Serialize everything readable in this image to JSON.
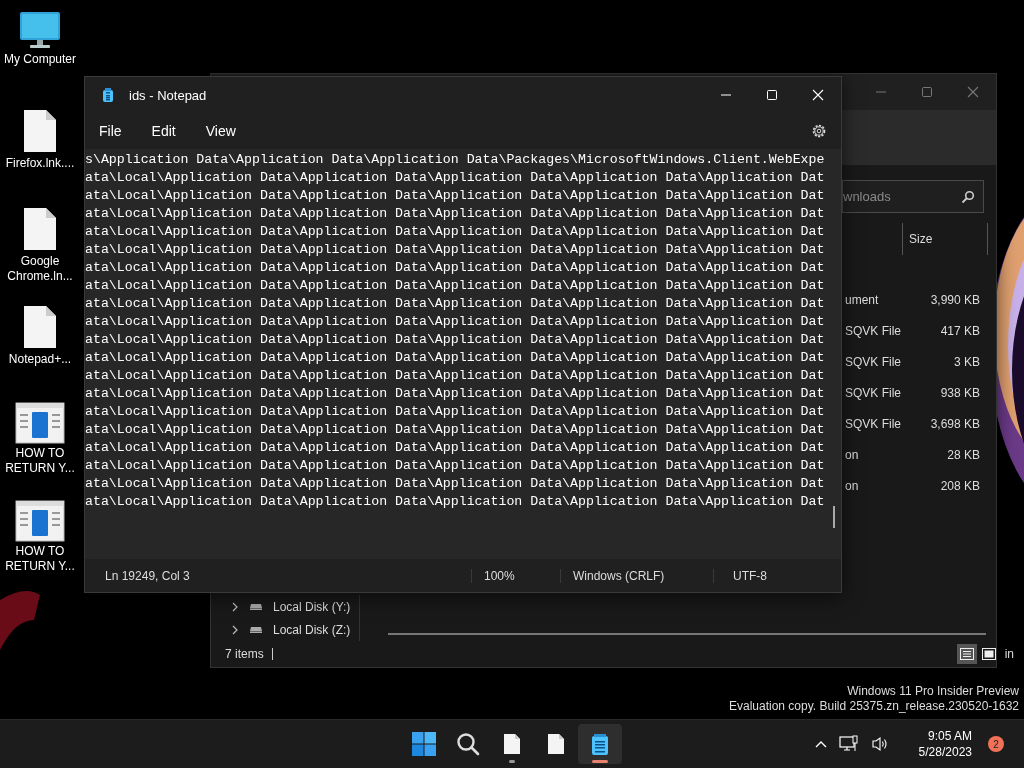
{
  "desktop_icons": [
    {
      "label": "My Computer",
      "kind": "computer"
    },
    {
      "label": "Firefox.lnk....",
      "kind": "file"
    },
    {
      "label": "Google Chrome.ln...",
      "kind": "file"
    },
    {
      "label": "Notepad+...",
      "kind": "file"
    },
    {
      "label": "HOW TO RETURN Y...",
      "kind": "document"
    },
    {
      "label": "HOW TO RETURN Y...",
      "kind": "document"
    }
  ],
  "explorer": {
    "search": {
      "placeholder": "wnloads"
    },
    "columns": [
      "Size"
    ],
    "rows": [
      {
        "type": "ument",
        "size": "3,990 KB"
      },
      {
        "type": "SQVK File",
        "size": "417 KB"
      },
      {
        "type": "SQVK File",
        "size": "3 KB"
      },
      {
        "type": "SQVK File",
        "size": "938 KB"
      },
      {
        "type": "SQVK File",
        "size": "3,698 KB"
      },
      {
        "type": "on",
        "size": "28 KB"
      },
      {
        "type": "on",
        "size": "208 KB"
      }
    ],
    "nav_items": [
      {
        "label": "Local Disk (Y:)"
      },
      {
        "label": "Local Disk (Z:)"
      }
    ],
    "status": "7 items",
    "view_buttons": [
      {
        "kind": "details",
        "selected": true
      },
      {
        "kind": "tiles",
        "selected": false
      }
    ],
    "edge_text": "in"
  },
  "notepad": {
    "title": "ids - Notepad",
    "menu": [
      "File",
      "Edit",
      "View"
    ],
    "lines": [
      "s\\Application Data\\Application Data\\Application Data\\Packages\\MicrosoftWindows.Client.WebExpe",
      "ata\\Local\\Application Data\\Application Data\\Application Data\\Application Data\\Application Dat",
      "ata\\Local\\Application Data\\Application Data\\Application Data\\Application Data\\Application Dat",
      "ata\\Local\\Application Data\\Application Data\\Application Data\\Application Data\\Application Dat",
      "ata\\Local\\Application Data\\Application Data\\Application Data\\Application Data\\Application Dat",
      "ata\\Local\\Application Data\\Application Data\\Application Data\\Application Data\\Application Dat",
      "ata\\Local\\Application Data\\Application Data\\Application Data\\Application Data\\Application Dat",
      "ata\\Local\\Application Data\\Application Data\\Application Data\\Application Data\\Application Dat",
      "ata\\Local\\Application Data\\Application Data\\Application Data\\Application Data\\Application Dat",
      "ata\\Local\\Application Data\\Application Data\\Application Data\\Application Data\\Application Dat",
      "ata\\Local\\Application Data\\Application Data\\Application Data\\Application Data\\Application Dat",
      "ata\\Local\\Application Data\\Application Data\\Application Data\\Application Data\\Application Dat",
      "ata\\Local\\Application Data\\Application Data\\Application Data\\Application Data\\Application Dat",
      "ata\\Local\\Application Data\\Application Data\\Application Data\\Application Data\\Application Dat",
      "ata\\Local\\Application Data\\Application Data\\Application Data\\Application Data\\Application Dat",
      "ata\\Local\\Application Data\\Application Data\\Application Data\\Application Data\\Application Dat",
      "ata\\Local\\Application Data\\Application Data\\Application Data\\Application Data\\Application Dat",
      "ata\\Local\\Application Data\\Application Data\\Application Data\\Application Data\\Application Dat",
      "ata\\Local\\Application Data\\Application Data\\Application Data\\Application Data\\Application Dat",
      "ata\\Local\\Application Data\\Application Data\\Application Data\\Application Data\\Application Dat"
    ],
    "status": [
      "Ln 19249, Col 3",
      "100%",
      "Windows (CRLF)",
      "UTF-8"
    ]
  },
  "watermark": [
    "Windows 11 Pro Insider Preview",
    "Evaluation copy. Build 25375.zn_release.230520-1632"
  ],
  "taskbar": {
    "apps": [
      {
        "kind": "start",
        "running": false,
        "selected": false
      },
      {
        "kind": "search",
        "running": false,
        "selected": false
      },
      {
        "kind": "file",
        "running": true,
        "selected": false
      },
      {
        "kind": "file",
        "running": false,
        "selected": false
      },
      {
        "kind": "notepad",
        "running": true,
        "selected": true
      }
    ],
    "time": "9:05 AM",
    "date": "5/28/2023",
    "badge": "2"
  }
}
